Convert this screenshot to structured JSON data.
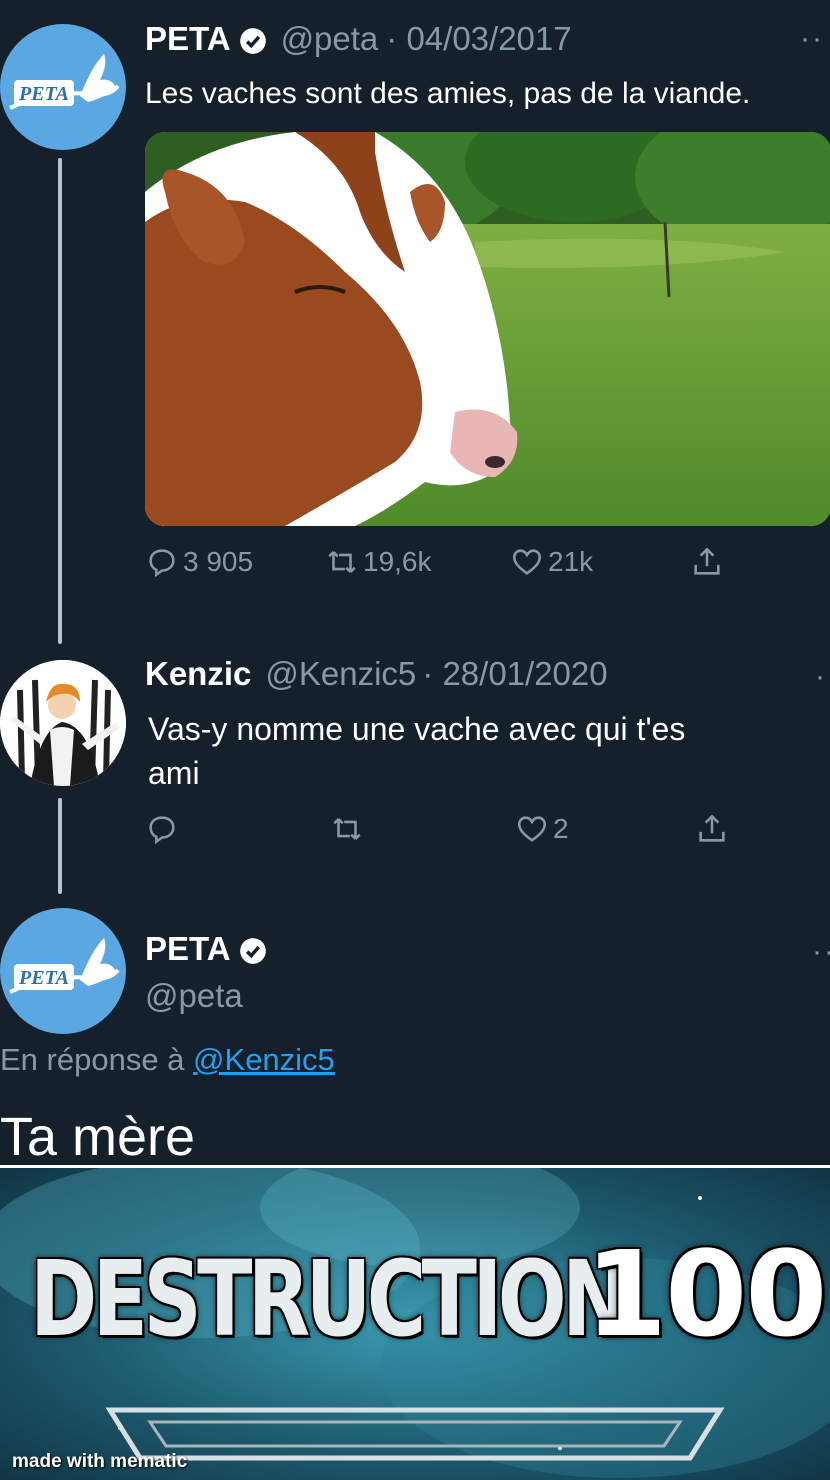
{
  "tweets": [
    {
      "name": "PETA",
      "handle": "@peta",
      "date": "· 04/03/2017",
      "text": "Les vaches sont des amies, pas de la viande.",
      "avatar_text": "PETA",
      "stats": {
        "replies": "3 905",
        "retweets": "19,6k",
        "likes": "21k"
      }
    },
    {
      "name": "Kenzic",
      "handle": "@Kenzic5",
      "date": "· 28/01/2020",
      "text_line1": "Vas-y nomme une vache avec qui t'es",
      "text_line2": "ami",
      "stats": {
        "likes": "2"
      }
    },
    {
      "name": "PETA",
      "handle": "@peta",
      "avatar_text": "PETA",
      "reply_prefix": "En réponse à",
      "reply_mention": "@Kenzic5",
      "text": "Ta mère"
    }
  ],
  "meme": {
    "word": "DESTRUCTION",
    "level": "100",
    "watermark": "made with mematic"
  },
  "colors": {
    "background": "#15202b",
    "secondary_text": "#8899a6",
    "link": "#1da1f2",
    "peta_blue": "#5aa7e1"
  },
  "icons": [
    "verified-badge-icon",
    "reply-icon",
    "retweet-icon",
    "like-icon",
    "share-icon",
    "more-icon"
  ]
}
